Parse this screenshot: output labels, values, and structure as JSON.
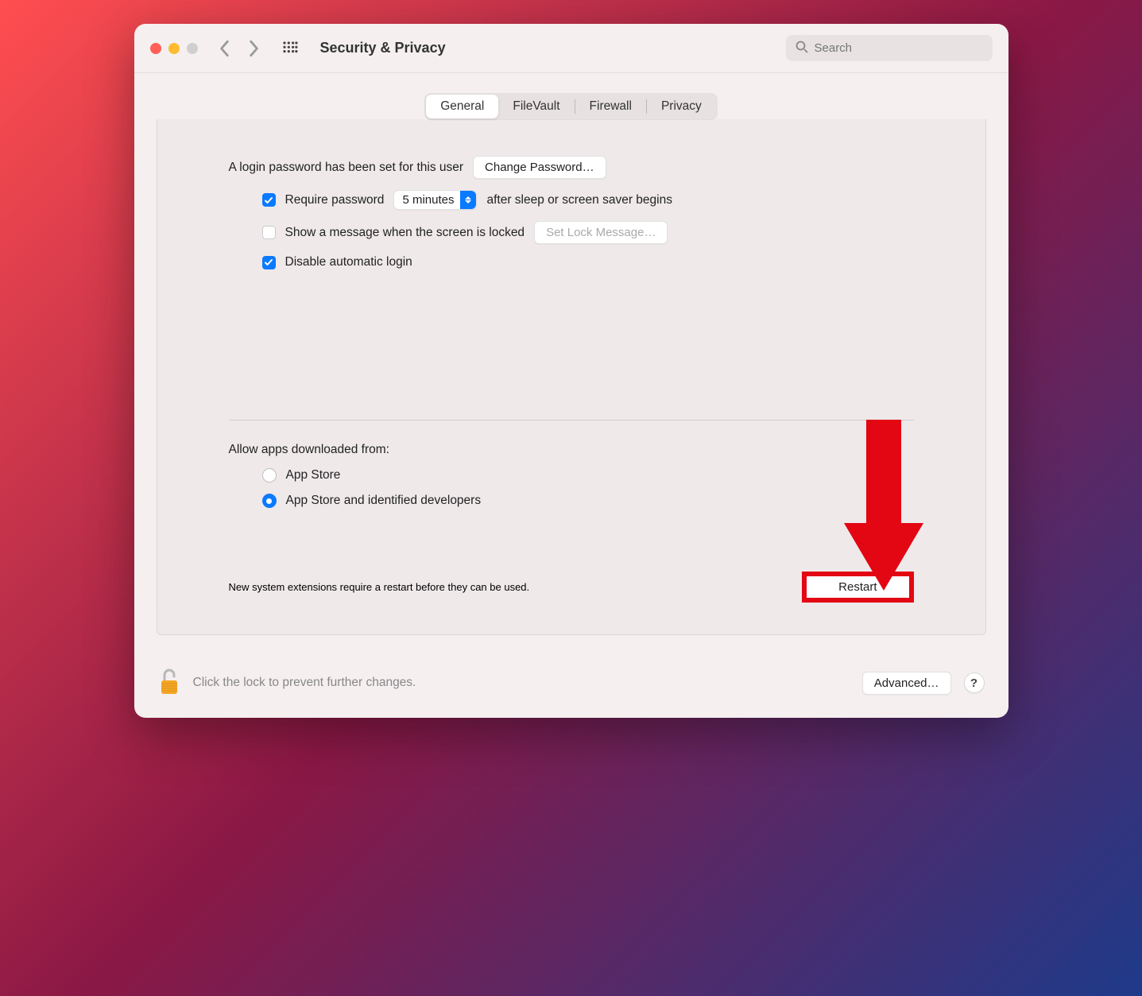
{
  "window": {
    "title": "Security & Privacy",
    "search_placeholder": "Search"
  },
  "tabs": {
    "general": "General",
    "filevault": "FileVault",
    "firewall": "Firewall",
    "privacy": "Privacy"
  },
  "general": {
    "password_set_text": "A login password has been set for this user",
    "change_password_label": "Change Password…",
    "require_password_label": "Require password",
    "require_password_checked": true,
    "delay_value": "5 minutes",
    "after_sleep_text": "after sleep or screen saver begins",
    "show_message_label": "Show a message when the screen is locked",
    "show_message_checked": false,
    "set_lock_message_label": "Set Lock Message…",
    "disable_auto_login_label": "Disable automatic login",
    "disable_auto_login_checked": true
  },
  "gatekeeper": {
    "heading": "Allow apps downloaded from:",
    "option_appstore": "App Store",
    "option_identified": "App Store and identified developers",
    "selected": "identified"
  },
  "extensions": {
    "message": "New system extensions require a restart before they can be used.",
    "restart_label": "Restart"
  },
  "footer": {
    "lock_text": "Click the lock to prevent further changes.",
    "advanced_label": "Advanced…",
    "help_label": "?"
  }
}
